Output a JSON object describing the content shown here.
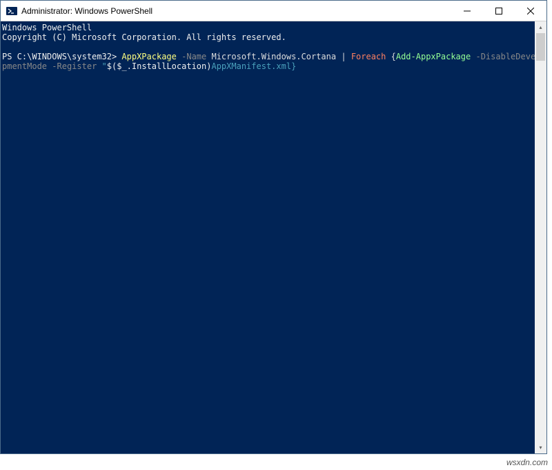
{
  "titlebar": {
    "title": "Administrator: Windows PowerShell"
  },
  "console": {
    "header1": "Windows PowerShell",
    "header2": "Copyright (C) Microsoft Corporation. All rights reserved.",
    "prompt": "PS C:\\WINDOWS\\system32>",
    "cmd1": "AppXPackage",
    "param1": "-Name",
    "arg1": "Microsoft.Windows.Cortana",
    "pipe": "|",
    "keyword1": "Foreach",
    "brace_open": "{",
    "cmd2": "Add-AppxPackage",
    "param2": "-DisableDevelopmentMode",
    "param3": "-Register",
    "str_open": "\"",
    "subexpr": "$($_.InstallLocation)",
    "str_rest": "AppXManifest.xml}"
  },
  "watermark": "wsxdn.com"
}
